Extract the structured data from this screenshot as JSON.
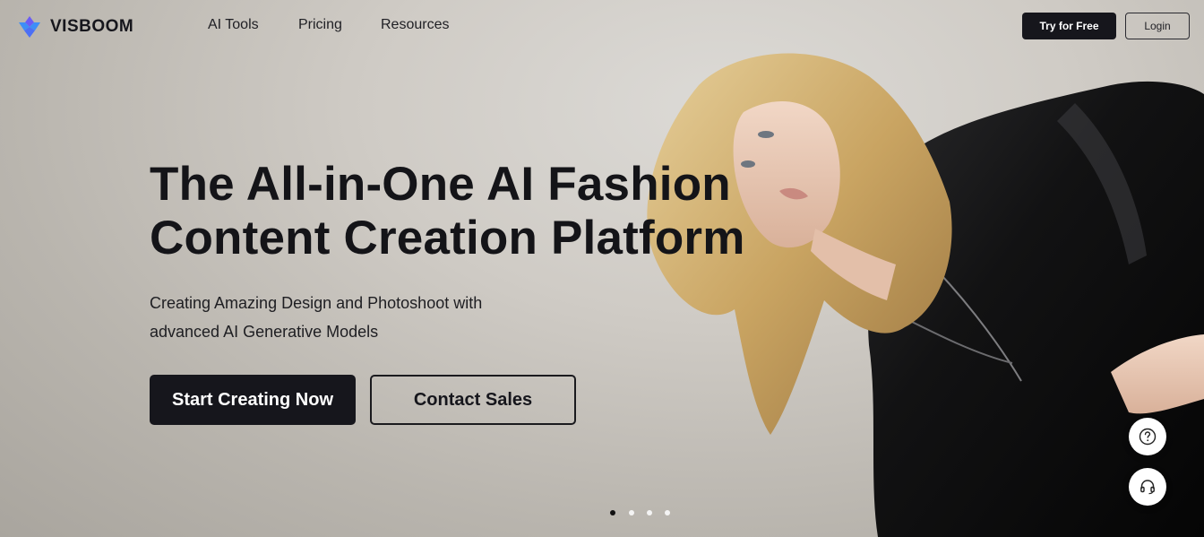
{
  "brand": {
    "name": "VISBOOM",
    "accent": "#4c6ff5"
  },
  "nav": {
    "items": [
      {
        "label": "AI Tools"
      },
      {
        "label": "Pricing"
      },
      {
        "label": "Resources"
      }
    ]
  },
  "header_actions": {
    "try_label": "Try for Free",
    "login_label": "Login"
  },
  "hero": {
    "headline_line1": "The All-in-One AI Fashion",
    "headline_line2": "Content Creation Platform",
    "sub_line1": "Creating Amazing Design and Photoshoot with",
    "sub_line2": "advanced AI Generative Models",
    "primary_cta": "Start Creating Now",
    "secondary_cta": "Contact Sales"
  },
  "floating": {
    "help_icon": "question-icon",
    "support_icon": "headset-icon"
  },
  "carousel": {
    "slide_count": 4,
    "active_index": 0
  },
  "colors": {
    "dark": "#16161c",
    "background": "#cfcbc5"
  }
}
